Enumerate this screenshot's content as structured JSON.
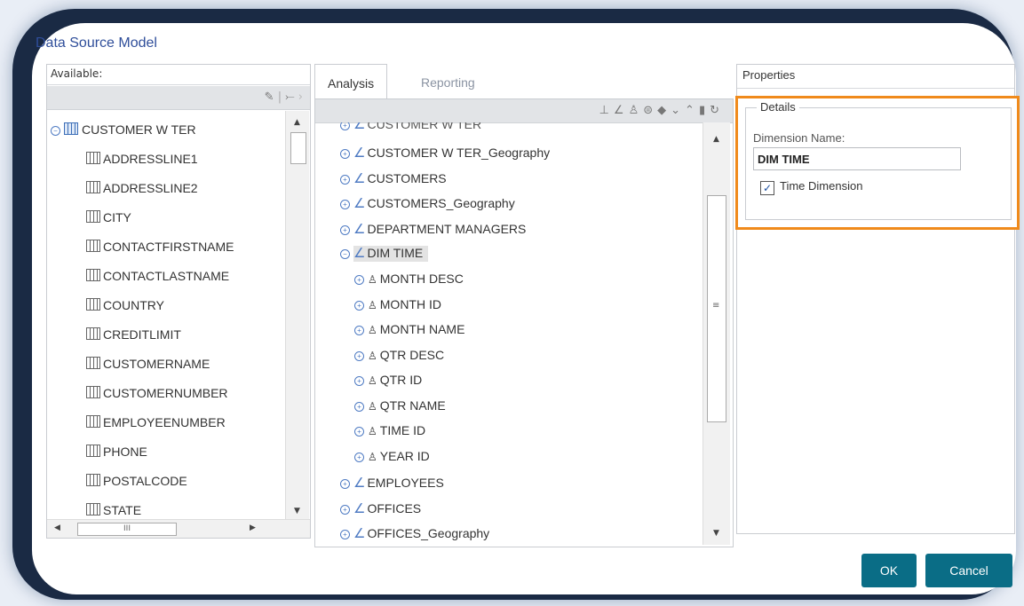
{
  "window": {
    "title": "Data Source Model"
  },
  "available": {
    "header": "Available:",
    "toolbar_icons": [
      "edit-icon",
      "split-icon",
      "chevron-right-icon"
    ],
    "root": "CUSTOMER W TER",
    "columns": [
      "ADDRESSLINE1",
      "ADDRESSLINE2",
      "CITY",
      "CONTACTFIRSTNAME",
      "CONTACTLASTNAME",
      "COUNTRY",
      "CREDITLIMIT",
      "CUSTOMERNAME",
      "CUSTOMERNUMBER",
      "EMPLOYEENUMBER",
      "PHONE",
      "POSTALCODE",
      "STATE"
    ]
  },
  "tabs": {
    "analysis": "Analysis",
    "reporting": "Reporting"
  },
  "analysis": {
    "partial_top": "CUSTOMER W TER",
    "items_before": [
      "CUSTOMER W TER_Geography",
      "CUSTOMERS",
      "CUSTOMERS_Geography",
      "DEPARTMENT MANAGERS"
    ],
    "selected": "DIM TIME",
    "levels": [
      "MONTH DESC",
      "MONTH ID",
      "MONTH NAME",
      "QTR DESC",
      "QTR ID",
      "QTR NAME",
      "TIME ID",
      "YEAR ID"
    ],
    "items_after": [
      "EMPLOYEES",
      "OFFICES",
      "OFFICES_Geography"
    ]
  },
  "properties": {
    "header": "Properties",
    "group": "Details",
    "dimension_label": "Dimension Name:",
    "dimension_value": "DIM TIME",
    "time_dimension_label": "Time Dimension",
    "time_dimension_checked": true
  },
  "buttons": {
    "ok": "OK",
    "cancel": "Cancel"
  },
  "colors": {
    "accent": "#0a6d86",
    "highlight": "#f08a1b",
    "title": "#2f4e9a"
  }
}
